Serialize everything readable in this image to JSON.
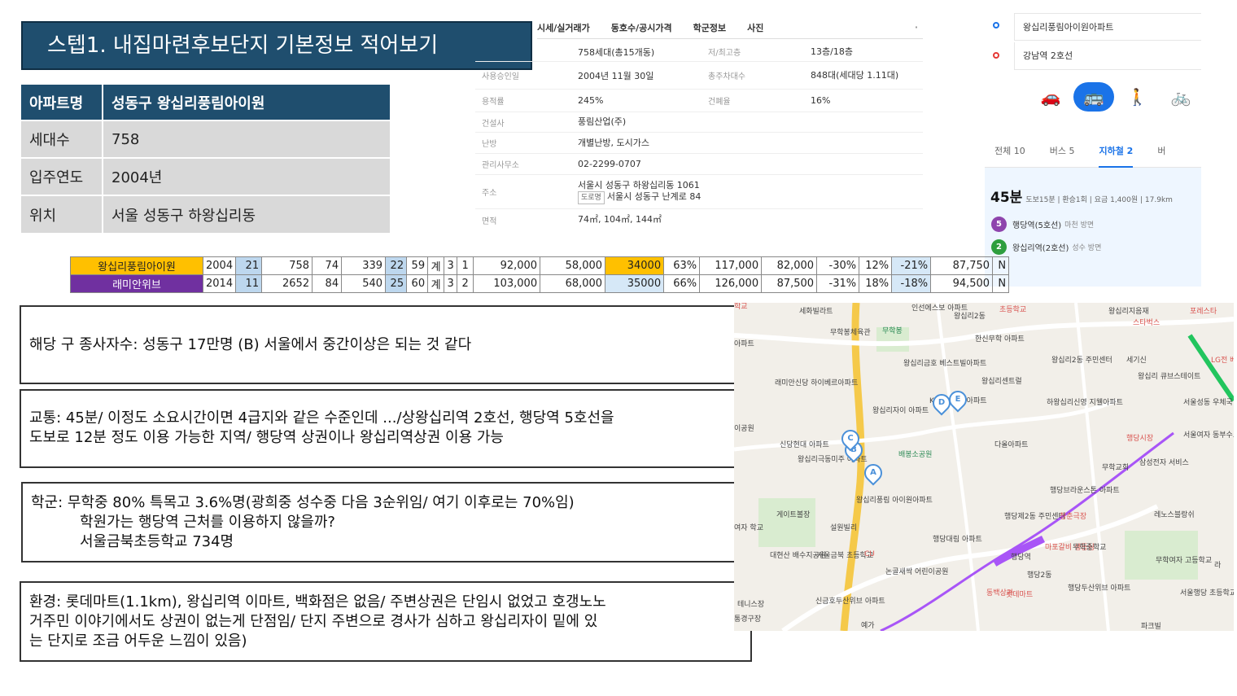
{
  "title": "스텝1. 내집마련후보단지 기본정보 적어보기",
  "info": {
    "header": {
      "key": "아파트명",
      "value": "성동구 왕십리풍림아이원"
    },
    "rows": [
      {
        "key": "세대수",
        "value": "758"
      },
      {
        "key": "입주연도",
        "value": "2004년"
      },
      {
        "key": "위치",
        "value": "서울 성동구 하왕십리동"
      }
    ]
  },
  "detail": {
    "tabs": [
      "시세/실거래가",
      "동호수/공시가격",
      "학군정보",
      "사진"
    ],
    "more": "·",
    "households": "758세대(총15개동)",
    "floors_label": "저/최고층",
    "floors": "13층/18층",
    "approval_label": "사용승인일",
    "approval": "2004년 11월 30일",
    "parking_label": "총주차대수",
    "parking": "848대(세대당 1.11대)",
    "far_label": "용적률",
    "far": "245%",
    "bcr_label": "건폐율",
    "bcr": "16%",
    "builder_label": "건설사",
    "builder": "풍림산업(주)",
    "heating_label": "난방",
    "heating": "개별난방, 도시가스",
    "office_label": "관리사무소",
    "office": "02-2299-0707",
    "address_label": "주소",
    "address": "서울시 성동구 하왕십리동 1061",
    "road_tag": "도로명",
    "road": "서울시 성동구 난계로 84",
    "area_label": "면적",
    "area": "74㎡, 104㎡, 144㎡"
  },
  "route": {
    "from": "왕십리풍림아이원아파트",
    "to": "강남역 2호선",
    "modes": [
      {
        "icon": "car-icon",
        "glyph": "🚗"
      },
      {
        "icon": "bus-icon",
        "glyph": "🚌"
      },
      {
        "icon": "walk-icon",
        "glyph": "🚶"
      },
      {
        "icon": "bike-icon",
        "glyph": "🚲"
      }
    ],
    "tabs": [
      "전체 10",
      "버스 5",
      "지하철 2",
      "버"
    ],
    "time": "45분",
    "summary": "도보15분 | 환승1회 | 요금 1,400원 | 17.9km",
    "stations": [
      {
        "line": "5",
        "name": "행당역(5호선)",
        "dir": "마천 방면",
        "color": "#8e44ad"
      },
      {
        "line": "2",
        "name": "왕십리역(2호선)",
        "dir": "성수 방면",
        "color": "#2e9e3e"
      }
    ]
  },
  "compare": {
    "rows": [
      [
        "왕십리풍림아이원",
        "2004",
        "21",
        "758",
        "74",
        "339",
        "22",
        "59",
        "계",
        "3",
        "1",
        "92,000",
        "58,000",
        "34000",
        "63%",
        "117,000",
        "82,000",
        "-30%",
        "12%",
        "-21%",
        "87,750",
        "N"
      ],
      [
        "래미안위브",
        "2014",
        "11",
        "2652",
        "84",
        "540",
        "25",
        "60",
        "계",
        "3",
        "2",
        "103,000",
        "68,000",
        "35000",
        "66%",
        "126,000",
        "87,500",
        "-31%",
        "18%",
        "-18%",
        "94,500",
        "N"
      ]
    ]
  },
  "notes": {
    "jobs": "해당 구 종사자수: 성동구 17만명 (B)  서울에서 중간이상은 되는 것 같다",
    "transport": [
      "교통: 45분/ 이정도 소요시간이면 4급지와 같은 수준인데 .../상왕십리역 2호선, 행당역 5호선을",
      "도보로 12분 정도 이용 가능한 지역/ 행당역 상권이나 왕십리역상권 이용 가능"
    ],
    "school": [
      "학군: 무학중 80% 특목고 3.6%명(광희중 성수중 다음 3순위임/ 여기 이후로는 70%임)",
      "학원가는 행당역 근처를 이용하지 않을까?",
      "서울금북초등학교 734명"
    ],
    "environment": [
      "환경: 롯데마트(1.1km), 왕십리역 이마트, 백화점은 없음/ 주변상권은 단임시 없었고 호갱노노",
      "거주민 이야기에서도 상권이 없는게 단점임/ 단지 주변으로 경사가 심하고 왕십리자이 밑에 있",
      "는 단지로 조금 어두운 느낌이 있음)"
    ]
  },
  "map": {
    "labels": [
      {
        "t": "세화빌라트",
        "c": ""
      },
      {
        "t": "무학봉체육관",
        "c": ""
      },
      {
        "t": "무학봉",
        "c": "green"
      },
      {
        "t": "인선에스보 아파트",
        "c": ""
      },
      {
        "t": "왕십리2동",
        "c": ""
      },
      {
        "t": "초등학교",
        "c": "orange"
      },
      {
        "t": "왕십리금호 베스트빌아파트",
        "c": ""
      },
      {
        "t": "한신무학 아파트",
        "c": ""
      },
      {
        "t": "왕십리센트럴",
        "c": ""
      },
      {
        "t": "래미안신당 하이베르아파트",
        "c": ""
      },
      {
        "t": "왕십리자이 아파트",
        "c": ""
      },
      {
        "t": "KCC 스위첸아파트",
        "c": ""
      },
      {
        "t": "신당현대 아파트",
        "c": ""
      },
      {
        "t": "왕십리극동미주 아파트",
        "c": ""
      },
      {
        "t": "배봉소공원",
        "c": "green"
      },
      {
        "t": "다올아파트",
        "c": ""
      },
      {
        "t": "왕십리풍림 아이원아파트",
        "c": ""
      },
      {
        "t": "게이트볼장",
        "c": ""
      },
      {
        "t": "설원빌리",
        "c": ""
      },
      {
        "t": "행당대림 아파트",
        "c": ""
      },
      {
        "t": "행당제2동 주민센터",
        "c": ""
      },
      {
        "t": "청춘극장",
        "c": "orange"
      },
      {
        "t": "서울금북 초등학교",
        "c": ""
      },
      {
        "t": "논골새싹 어린이공원",
        "c": ""
      },
      {
        "t": "행당역",
        "c": ""
      },
      {
        "t": "행당2동",
        "c": ""
      },
      {
        "t": "마포갈비 생등심",
        "c": "orange"
      },
      {
        "t": "무학중학교",
        "c": ""
      },
      {
        "t": "동백상가",
        "c": "orange"
      },
      {
        "t": "롯데마트",
        "c": "orange"
      },
      {
        "t": "행당두산위브 아파트",
        "c": ""
      },
      {
        "t": "신금호두산위브 아파트",
        "c": ""
      },
      {
        "t": "왕십리2동 주민센터",
        "c": ""
      },
      {
        "t": "세기신",
        "c": ""
      },
      {
        "t": "왕십리 큐브스테이트",
        "c": ""
      },
      {
        "t": "하왕십리신영 지웰아파트",
        "c": ""
      },
      {
        "t": "행당시장",
        "c": "orange"
      },
      {
        "t": "무학교회",
        "c": ""
      },
      {
        "t": "삼성전자 서비스",
        "c": ""
      },
      {
        "t": "행당브라운스톤 아파트",
        "c": ""
      },
      {
        "t": "레노스블랑쉬",
        "c": ""
      },
      {
        "t": "무학여자 고등학교",
        "c": ""
      },
      {
        "t": "서울행당 초등학교",
        "c": ""
      },
      {
        "t": "왕십리지음재",
        "c": ""
      },
      {
        "t": "스타벅스",
        "c": "orange"
      },
      {
        "t": "포레스타",
        "c": "orange"
      },
      {
        "t": "서울성동 우체국",
        "c": ""
      },
      {
        "t": "서울여자 동부수도사",
        "c": ""
      },
      {
        "t": "대현산 배수지공원",
        "c": ""
      },
      {
        "t": "테니스장",
        "c": ""
      },
      {
        "t": "CU",
        "c": "orange"
      },
      {
        "t": "학교",
        "c": "orange"
      },
      {
        "t": "아파트",
        "c": ""
      },
      {
        "t": "이공원",
        "c": ""
      },
      {
        "t": "LG전 베스",
        "c": "orange"
      },
      {
        "t": "여자 학교",
        "c": ""
      },
      {
        "t": "예가",
        "c": ""
      },
      {
        "t": "파크빌",
        "c": ""
      },
      {
        "t": "라",
        "c": ""
      },
      {
        "t": "통경구장",
        "c": ""
      }
    ],
    "pins": [
      "A",
      "B",
      "C",
      "D",
      "E"
    ]
  }
}
